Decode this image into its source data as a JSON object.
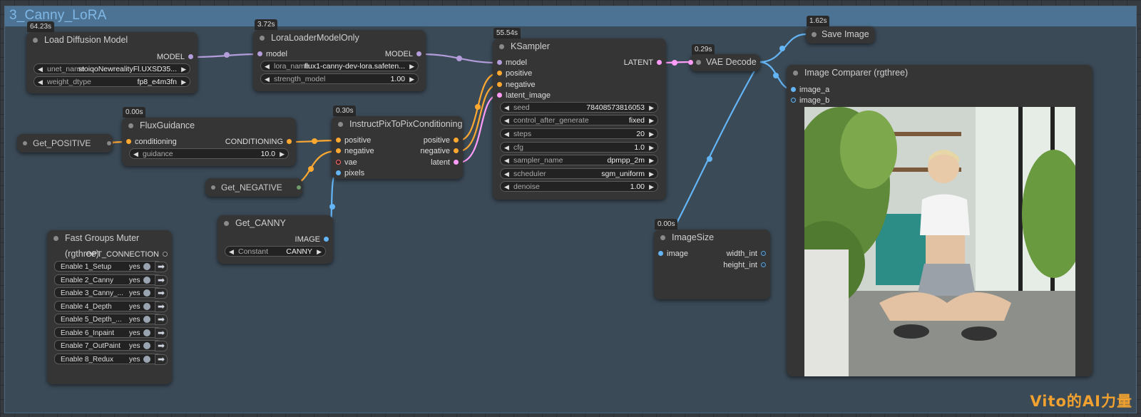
{
  "group": {
    "title": "3_Canny_LoRA"
  },
  "colors": {
    "model": "#b39ddb",
    "conditioning": "#ffa931",
    "latent": "#ff9cf9",
    "image": "#64b5f6",
    "vae": "#ff6e6e"
  },
  "nodes": {
    "load_model": {
      "time": "64.23s",
      "title": "Load Diffusion Model",
      "output": "MODEL",
      "widgets": [
        {
          "label": "unet_name",
          "value": "stoiqoNewrealityFl.UXSD35..."
        },
        {
          "label": "weight_dtype",
          "value": "fp8_e4m3fn"
        }
      ]
    },
    "lora": {
      "time": "3.72s",
      "title": "LoraLoaderModelOnly",
      "input": "model",
      "output": "MODEL",
      "widgets": [
        {
          "label": "lora_name",
          "value": "flux1-canny-dev-lora.safeten..."
        },
        {
          "label": "strength_model",
          "value": "1.00"
        }
      ]
    },
    "flux": {
      "time": "0.00s",
      "title": "FluxGuidance",
      "input": "conditioning",
      "output": "CONDITIONING",
      "widgets": [
        {
          "label": "guidance",
          "value": "10.0"
        }
      ]
    },
    "ipp": {
      "time": "0.30s",
      "title": "InstructPixToPixConditioning",
      "inputs": [
        "positive",
        "negative",
        "vae",
        "pixels"
      ],
      "outputs": [
        "positive",
        "negative",
        "latent"
      ]
    },
    "ksampler": {
      "time": "55.54s",
      "title": "KSampler",
      "inputs": [
        "model",
        "positive",
        "negative",
        "latent_image"
      ],
      "output": "LATENT",
      "widgets": [
        {
          "label": "seed",
          "value": "78408573816053"
        },
        {
          "label": "control_after_generate",
          "value": "fixed"
        },
        {
          "label": "steps",
          "value": "20"
        },
        {
          "label": "cfg",
          "value": "1.0"
        },
        {
          "label": "sampler_name",
          "value": "dpmpp_2m"
        },
        {
          "label": "scheduler",
          "value": "sgm_uniform"
        },
        {
          "label": "denoise",
          "value": "1.00"
        }
      ]
    },
    "vae_decode": {
      "time": "0.29s",
      "title": "VAE Decode"
    },
    "save": {
      "time": "1.62s",
      "title": "Save Image"
    },
    "comparer": {
      "title": "Image Comparer (rgthree)",
      "inputs": [
        "image_a",
        "image_b"
      ]
    },
    "imagesize": {
      "time": "0.00s",
      "title": "ImageSize",
      "input": "image",
      "outputs": [
        "width_int",
        "height_int"
      ]
    },
    "get_positive": {
      "title": "Get_POSITIVE"
    },
    "get_negative": {
      "title": "Get_NEGATIVE"
    },
    "get_canny": {
      "title": "Get_CANNY",
      "output": "IMAGE",
      "widgets": [
        {
          "label": "Constant",
          "value": "CANNY"
        }
      ]
    },
    "muter": {
      "title": "Fast Groups Muter (rgthree)",
      "output": "OPT_CONNECTION",
      "rows": [
        {
          "label": "Enable 1_Setup",
          "state": "yes"
        },
        {
          "label": "Enable 2_Canny",
          "state": "yes"
        },
        {
          "label": "Enable 3_Canny_...",
          "state": "yes"
        },
        {
          "label": "Enable 4_Depth",
          "state": "yes"
        },
        {
          "label": "Enable 5_Depth_...",
          "state": "yes"
        },
        {
          "label": "Enable 6_Inpaint",
          "state": "yes"
        },
        {
          "label": "Enable 7_OutPaint",
          "state": "yes"
        },
        {
          "label": "Enable 8_Redux",
          "state": "yes"
        }
      ]
    }
  },
  "watermark": "Vito的AI力量"
}
